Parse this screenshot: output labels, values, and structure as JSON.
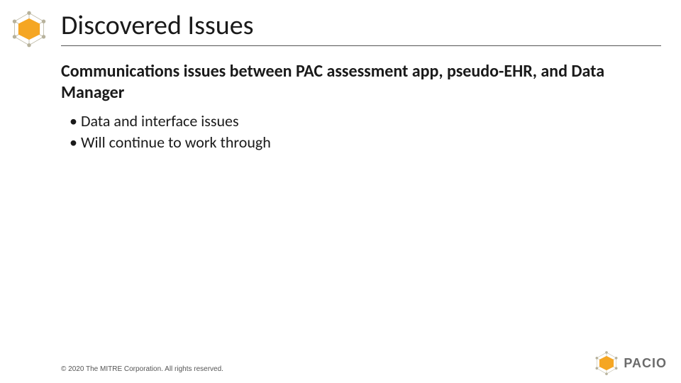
{
  "header": {
    "title": "Discovered Issues"
  },
  "content": {
    "subhead": "Communications issues between PAC assessment app, pseudo-EHR, and Data Manager",
    "bullets": [
      "Data and interface issues",
      "Will continue to work through"
    ]
  },
  "footer": {
    "copyright": "© 2020 The MITRE Corporation. All rights reserved."
  },
  "brand": {
    "name": "PACIO"
  },
  "colors": {
    "accent": "#f5a623",
    "edge": "#b7b29c",
    "text_muted": "#6b6b6b"
  }
}
